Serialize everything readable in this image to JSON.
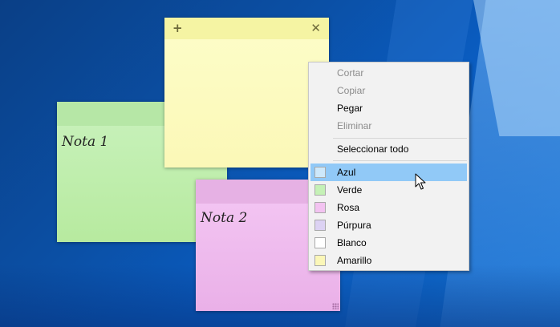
{
  "notes": {
    "green": {
      "text": "Nota 1"
    },
    "yellow": {
      "add_glyph": "+",
      "close_glyph": "✕"
    },
    "pink": {
      "text": "Nota 2"
    }
  },
  "context_menu": {
    "edit_items": [
      {
        "label": "Cortar",
        "enabled": false
      },
      {
        "label": "Copiar",
        "enabled": false
      },
      {
        "label": "Pegar",
        "enabled": true
      },
      {
        "label": "Eliminar",
        "enabled": false
      }
    ],
    "select_all": {
      "label": "Seleccionar todo",
      "enabled": true
    },
    "colors": [
      {
        "label": "Azul",
        "swatch": "#cde8fb",
        "highlighted": true
      },
      {
        "label": "Verde",
        "swatch": "#c5f1b6"
      },
      {
        "label": "Rosa",
        "swatch": "#f3c3f1"
      },
      {
        "label": "Púrpura",
        "swatch": "#dcd2f3"
      },
      {
        "label": "Blanco",
        "swatch": "#ffffff"
      },
      {
        "label": "Amarillo",
        "swatch": "#fbf7b8"
      }
    ]
  },
  "colors": {
    "menu_background": "#f2f2f2",
    "menu_highlight": "#91c9f7",
    "disabled_text": "#8c8c8c"
  },
  "icons": {
    "add": "plus-icon",
    "close": "close-icon",
    "cursor": "mouse-pointer-icon"
  }
}
